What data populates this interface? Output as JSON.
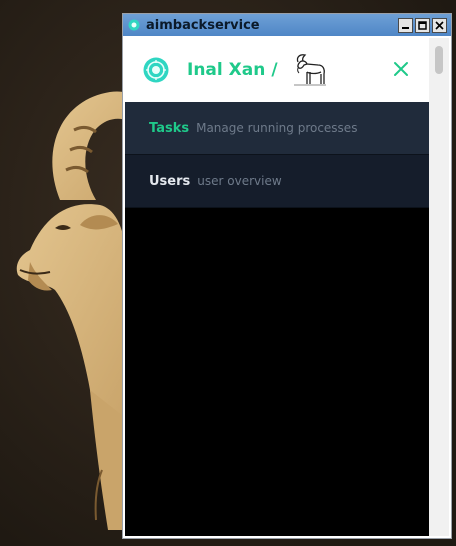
{
  "window": {
    "title": "aimbackservice",
    "controls": {
      "minimize": "_",
      "maximize": "□",
      "close": "×"
    }
  },
  "header": {
    "username": "Inal Xan",
    "separator": "/",
    "brand_color": "#1fc98a"
  },
  "nav": {
    "items": [
      {
        "label": "Tasks",
        "description": "Manage running processes",
        "active": true
      },
      {
        "label": "Users",
        "description": "user overview",
        "active": false
      }
    ]
  },
  "icons": {
    "app": "app-gear-icon",
    "logo": "gear-logo-icon",
    "goat": "goat-icon",
    "close": "close-icon"
  }
}
